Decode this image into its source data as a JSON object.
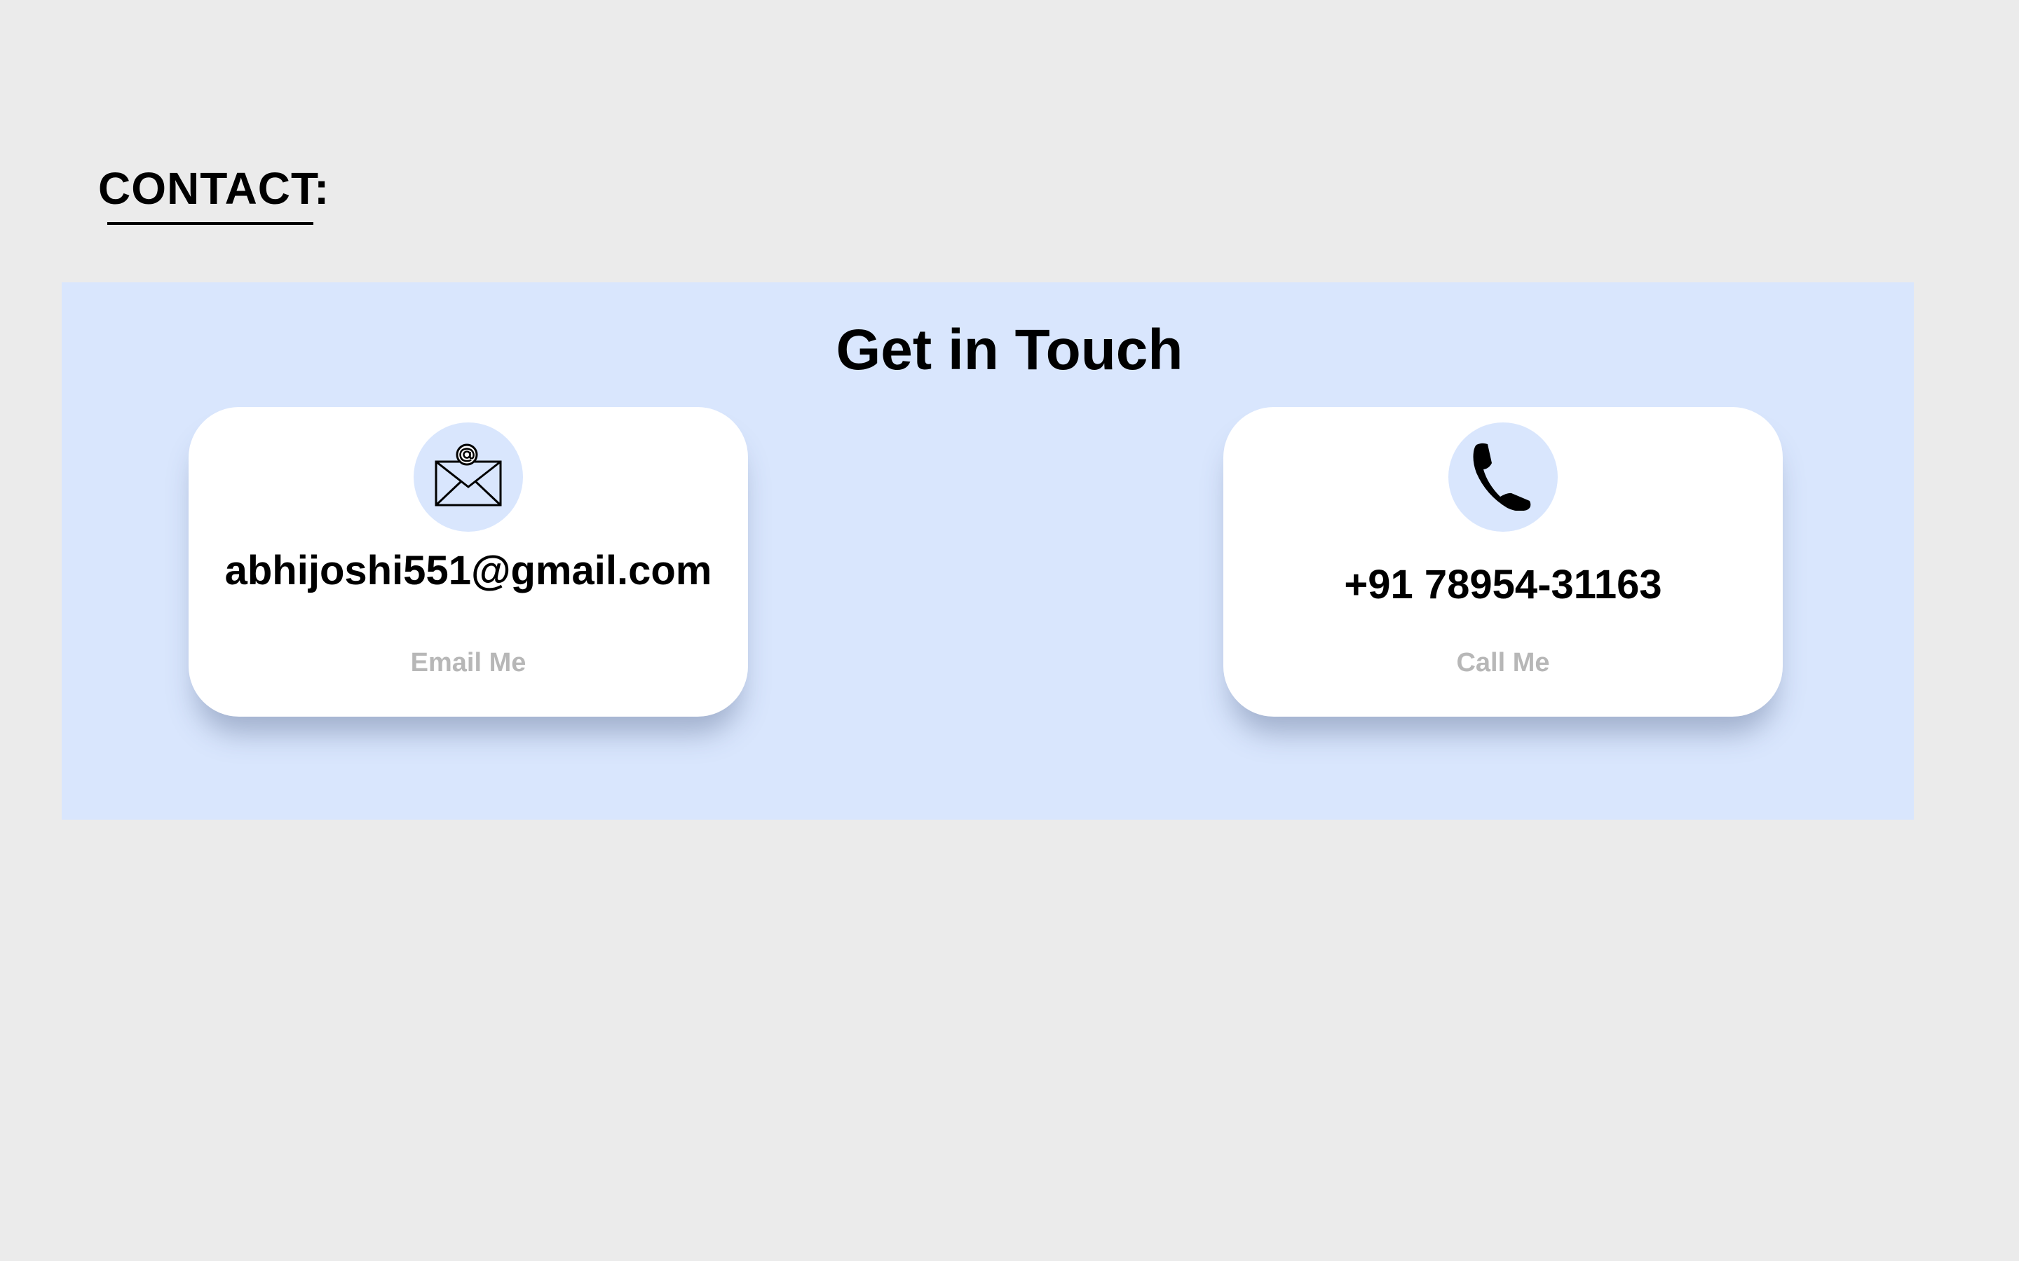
{
  "section": {
    "heading": "CONTACT:"
  },
  "contact": {
    "title": "Get in Touch",
    "email": {
      "icon": "envelope-at-icon",
      "value": "abhijoshi551@gmail.com",
      "action_label": "Email Me"
    },
    "phone": {
      "icon": "phone-icon",
      "value": "+91 78954-31163",
      "action_label": "Call Me"
    }
  },
  "colors": {
    "page_background": "#ebebeb",
    "band_background": "#d9e6fd",
    "card_background": "#ffffff",
    "action_text": "#b7b7b7"
  }
}
